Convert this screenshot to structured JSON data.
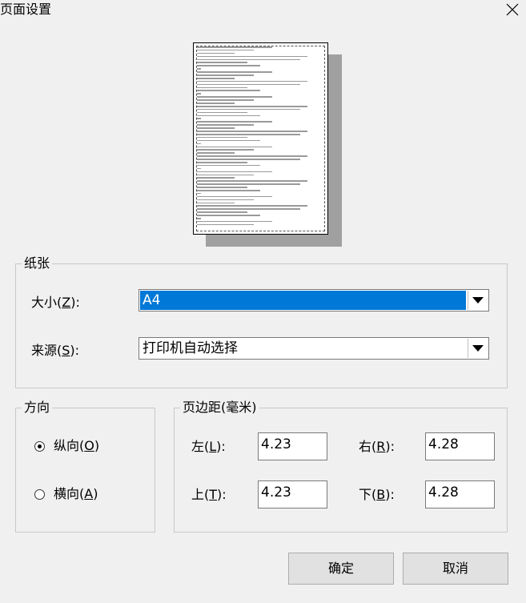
{
  "window": {
    "title": "页面设置",
    "close_icon": "close-icon"
  },
  "preview": {
    "description_icon": "page-preview"
  },
  "paper": {
    "legend": "纸张",
    "size": {
      "label_pre": "大小(",
      "accel": "Z",
      "label_post": "):",
      "value": "A4"
    },
    "source": {
      "label_pre": "来源(",
      "accel": "S",
      "label_post": "):",
      "value": "打印机自动选择"
    }
  },
  "orientation": {
    "legend": "方向",
    "portrait": {
      "label_pre": "纵向(",
      "accel": "O",
      "label_post": ")",
      "selected": true
    },
    "landscape": {
      "label_pre": "横向(",
      "accel": "A",
      "label_post": ")",
      "selected": false
    }
  },
  "margins": {
    "legend": "页边距(毫米)",
    "left": {
      "label_pre": "左(",
      "accel": "L",
      "label_post": "):",
      "value": "4.23"
    },
    "right": {
      "label_pre": "右(",
      "accel": "R",
      "label_post": "):",
      "value": "4.28"
    },
    "top": {
      "label_pre": "上(",
      "accel": "T",
      "label_post": "):",
      "value": "4.23"
    },
    "bottom": {
      "label_pre": "下(",
      "accel": "B",
      "label_post": "):",
      "value": "4.28"
    }
  },
  "buttons": {
    "ok": "确定",
    "cancel": "取消"
  },
  "colors": {
    "selection": "#0078d7",
    "background": "#f0f0f0"
  }
}
